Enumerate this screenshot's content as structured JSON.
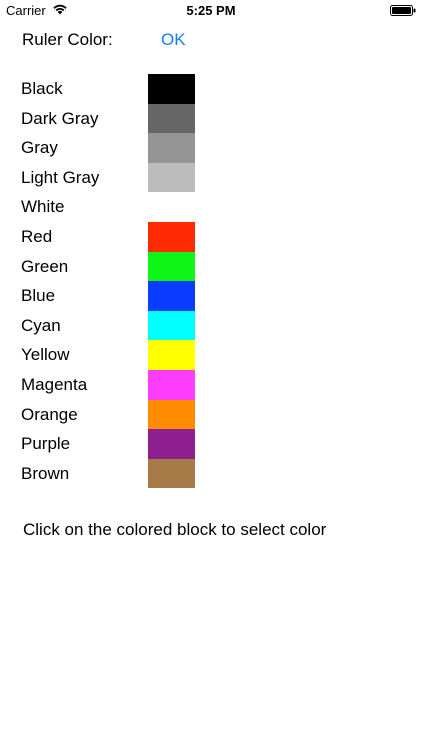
{
  "status_bar": {
    "carrier": "Carrier",
    "time": "5:25 PM",
    "wifi_icon": "wifi-icon",
    "battery_icon": "battery-icon"
  },
  "header": {
    "label": "Ruler Color:",
    "ok_label": "OK",
    "ok_color": "#1a7ee6"
  },
  "colors": [
    {
      "name": "Black",
      "swatch": "#000000"
    },
    {
      "name": "Dark Gray",
      "swatch": "#666666"
    },
    {
      "name": "Gray",
      "swatch": "#959595"
    },
    {
      "name": "Light Gray",
      "swatch": "#bcbcbc"
    },
    {
      "name": "White",
      "swatch": "#ffffff"
    },
    {
      "name": "Red",
      "swatch": "#ff2a00"
    },
    {
      "name": "Green",
      "swatch": "#0ef516"
    },
    {
      "name": "Blue",
      "swatch": "#0a3cff"
    },
    {
      "name": "Cyan",
      "swatch": "#00ffff"
    },
    {
      "name": "Yellow",
      "swatch": "#ffff00"
    },
    {
      "name": "Magenta",
      "swatch": "#ff3dff"
    },
    {
      "name": "Orange",
      "swatch": "#ff8c00"
    },
    {
      "name": "Purple",
      "swatch": "#8e1f8e"
    },
    {
      "name": "Brown",
      "swatch": "#a87a48"
    }
  ],
  "instruction": "Click on the colored block to select color"
}
